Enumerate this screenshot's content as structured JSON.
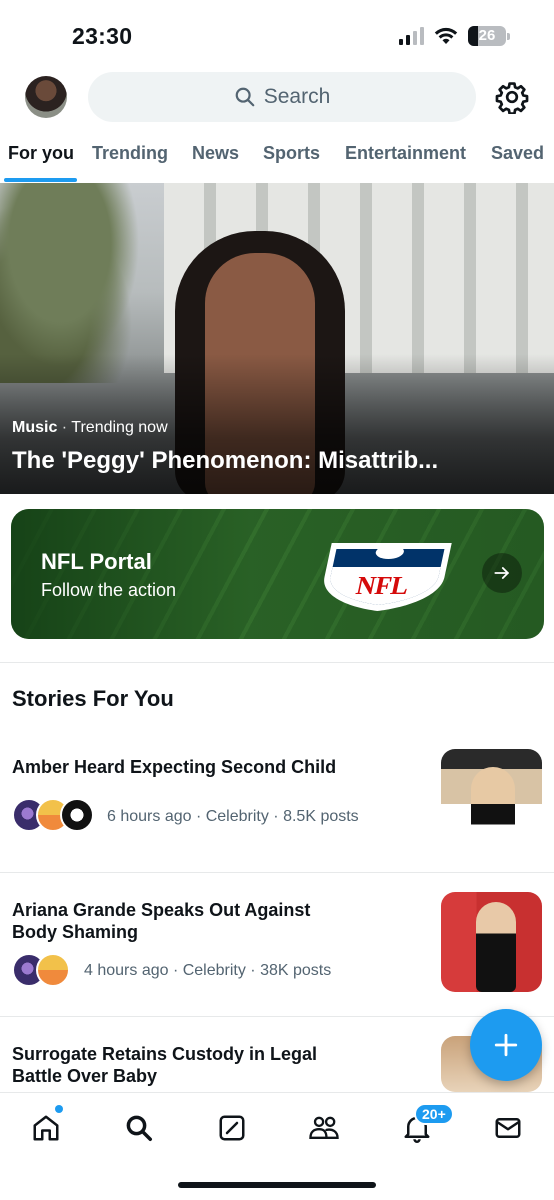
{
  "status_bar": {
    "time": "23:30",
    "battery": "26"
  },
  "header": {
    "search_placeholder": "Search"
  },
  "tabs": [
    {
      "label": "For you",
      "active": true
    },
    {
      "label": "Trending",
      "active": false
    },
    {
      "label": "News",
      "active": false
    },
    {
      "label": "Sports",
      "active": false
    },
    {
      "label": "Entertainment",
      "active": false
    },
    {
      "label": "Saved",
      "active": false
    }
  ],
  "hero": {
    "category": "Music",
    "context": "Trending now",
    "separator": "·",
    "title": "The 'Peggy' Phenomenon: Misattrib..."
  },
  "nfl_portal": {
    "title": "NFL Portal",
    "subtitle": "Follow the action",
    "logo_text": "NFL"
  },
  "stories_section": {
    "title": "Stories For You"
  },
  "stories": [
    {
      "title": "Amber Heard Expecting Second Child",
      "meta": "6 hours ago · Celebrity · 8.5K posts"
    },
    {
      "title": "Ariana Grande Speaks Out Against Body Shaming",
      "meta": "4 hours ago · Celebrity · 38K posts"
    },
    {
      "title": "Surrogate Retains Custody in Legal Battle Over Baby",
      "meta": ""
    }
  ],
  "bottom_nav": {
    "notifications_badge": "20+"
  },
  "colors": {
    "accent": "#1d9bf0",
    "text": "#0f1419",
    "secondary": "#536471",
    "nfl_field": "#2f6a2a"
  }
}
